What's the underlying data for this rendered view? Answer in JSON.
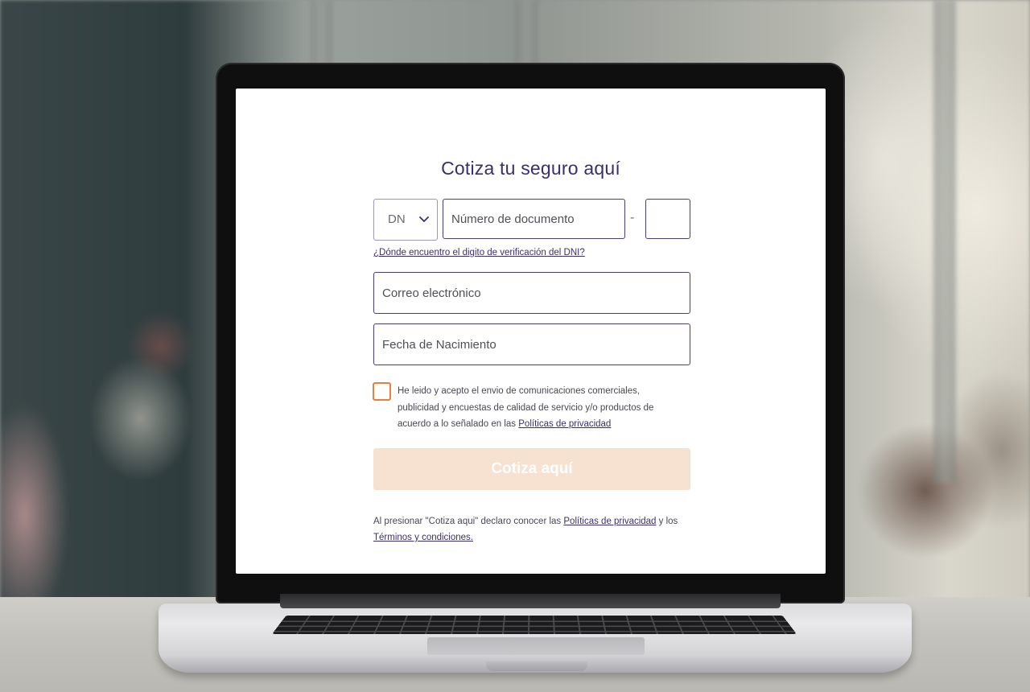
{
  "form": {
    "title": "Cotiza tu seguro aquí",
    "document_type": {
      "selected": "DN"
    },
    "document_number": {
      "placeholder": "Número de documento",
      "value": ""
    },
    "separator": "-",
    "verification_digit": {
      "value": ""
    },
    "help_link": "¿Dónde encuentro el digito de verificación del DNI?",
    "email": {
      "placeholder": "Correo electrónico",
      "value": ""
    },
    "birth_date": {
      "placeholder": "Fecha de Nacimiento",
      "value": ""
    },
    "consent": {
      "checked": false,
      "text": "He leido y acepto el envio de comunicaciones comerciales, publicidad y encuestas de calidad de servicio y/o productos de acuerdo a lo señalado en las",
      "link": "Políticas de privacidad"
    },
    "submit_label": "Cotiza aquí",
    "legal": {
      "prefix": "Al presionar \"Cotiza aqui\" declaro conocer las",
      "privacy_link": "Políticas de privacidad",
      "connector": "y los",
      "terms_link": "Términos y condiciones."
    }
  },
  "colors": {
    "brand_purple": "#3b2e6c",
    "accent_orange": "#e87f3c",
    "button_disabled": "#f7e2d2"
  },
  "icons": {
    "select_arrow": "chevron-down-icon"
  }
}
